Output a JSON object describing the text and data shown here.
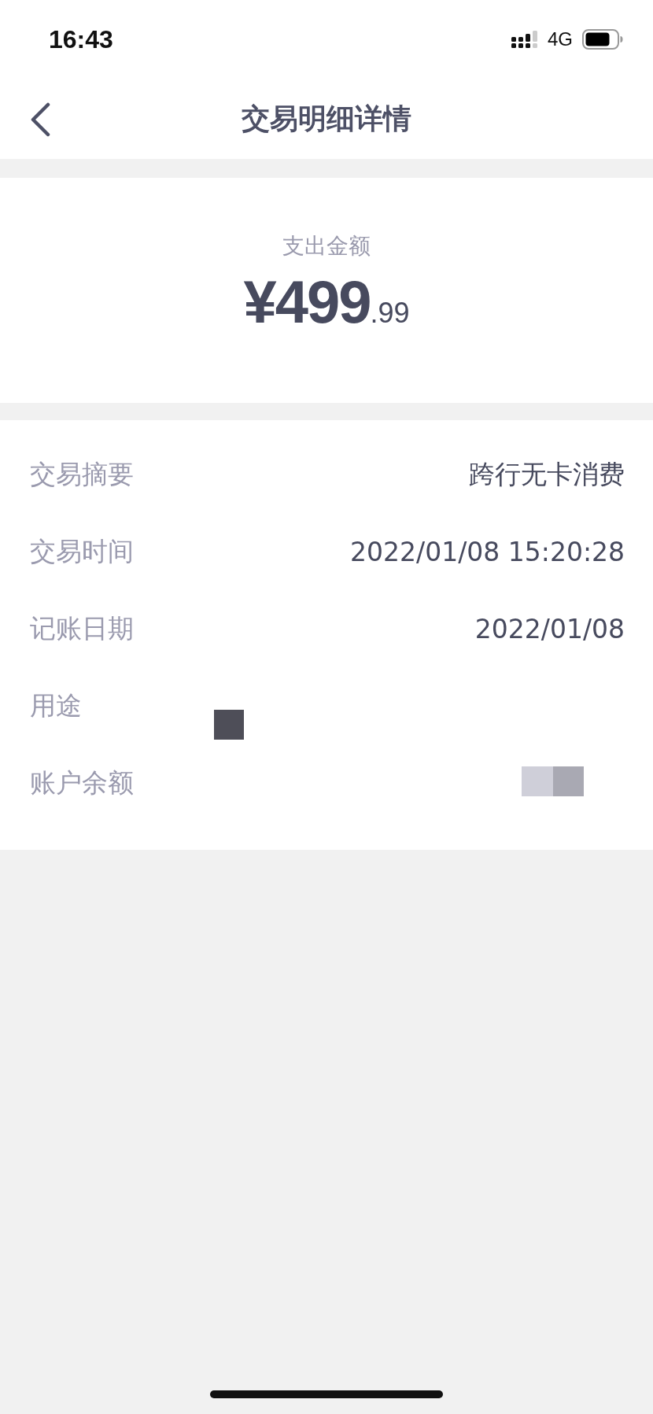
{
  "status_bar": {
    "time": "16:43",
    "network": "4G"
  },
  "nav": {
    "title": "交易明细详情"
  },
  "amount": {
    "label": "支出金额",
    "currency": "¥",
    "integer": "499",
    "decimal": ".99"
  },
  "details": [
    {
      "label": "交易摘要",
      "value": "跨行无卡消费",
      "redacted": false
    },
    {
      "label": "交易时间",
      "value": "2022/01/08 15:20:28",
      "redacted": false
    },
    {
      "label": "记账日期",
      "value": "2022/01/08",
      "redacted": false
    },
    {
      "label": "用途",
      "redacted": true
    },
    {
      "label": "账户余额",
      "redacted": true
    }
  ]
}
